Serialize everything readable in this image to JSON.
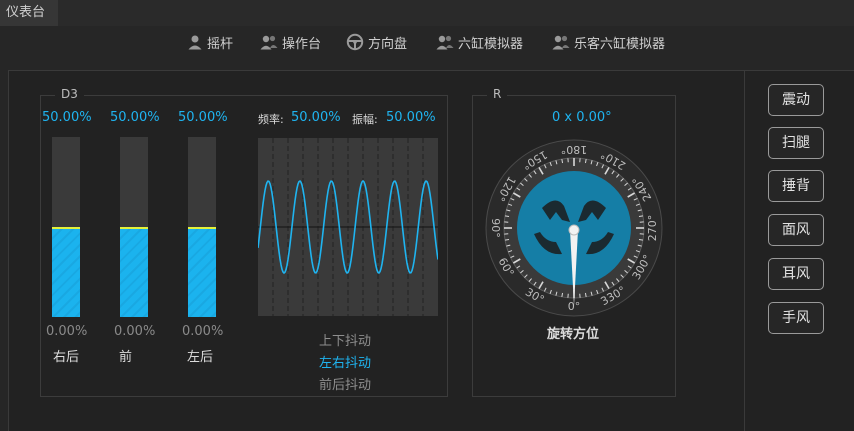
{
  "tab": {
    "label": "仪表台"
  },
  "nav": [
    {
      "label": "摇杆"
    },
    {
      "label": "操作台"
    },
    {
      "label": "方向盘"
    },
    {
      "label": "六缸模拟器"
    },
    {
      "label": "乐客六缸模拟器"
    }
  ],
  "d3": {
    "title": "D3",
    "bars": [
      {
        "value_label": "50.00%",
        "fill": 0.5,
        "bottom_label": "0.00%",
        "name": "右后"
      },
      {
        "value_label": "50.00%",
        "fill": 0.5,
        "bottom_label": "0.00%",
        "name": "前"
      },
      {
        "value_label": "50.00%",
        "fill": 0.5,
        "bottom_label": "0.00%",
        "name": "左后"
      }
    ],
    "frequency": {
      "label": "频率:",
      "value": "50.00%"
    },
    "amplitude": {
      "label": "振幅:",
      "value": "50.00%"
    },
    "modes": [
      {
        "label": "上下抖动",
        "active": false
      },
      {
        "label": "左右抖动",
        "active": true
      },
      {
        "label": "前后抖动",
        "active": false
      }
    ]
  },
  "r": {
    "title": "R",
    "readout": "0 x 0.00°",
    "angle": 0,
    "dial_labels": [
      "0°",
      "30°",
      "60°",
      "90°",
      "120°",
      "150°",
      "180°",
      "210°",
      "240°",
      "270°",
      "300°",
      "330°"
    ],
    "caption": "旋转方位"
  },
  "side_buttons": [
    {
      "label": "震动"
    },
    {
      "label": "扫腿"
    },
    {
      "label": "捶背"
    },
    {
      "label": "面风"
    },
    {
      "label": "耳风"
    },
    {
      "label": "手风"
    }
  ],
  "colors": {
    "accent": "#1fb4f0",
    "bar_top": "#e4f23a",
    "dial_face": "#157ea6"
  }
}
